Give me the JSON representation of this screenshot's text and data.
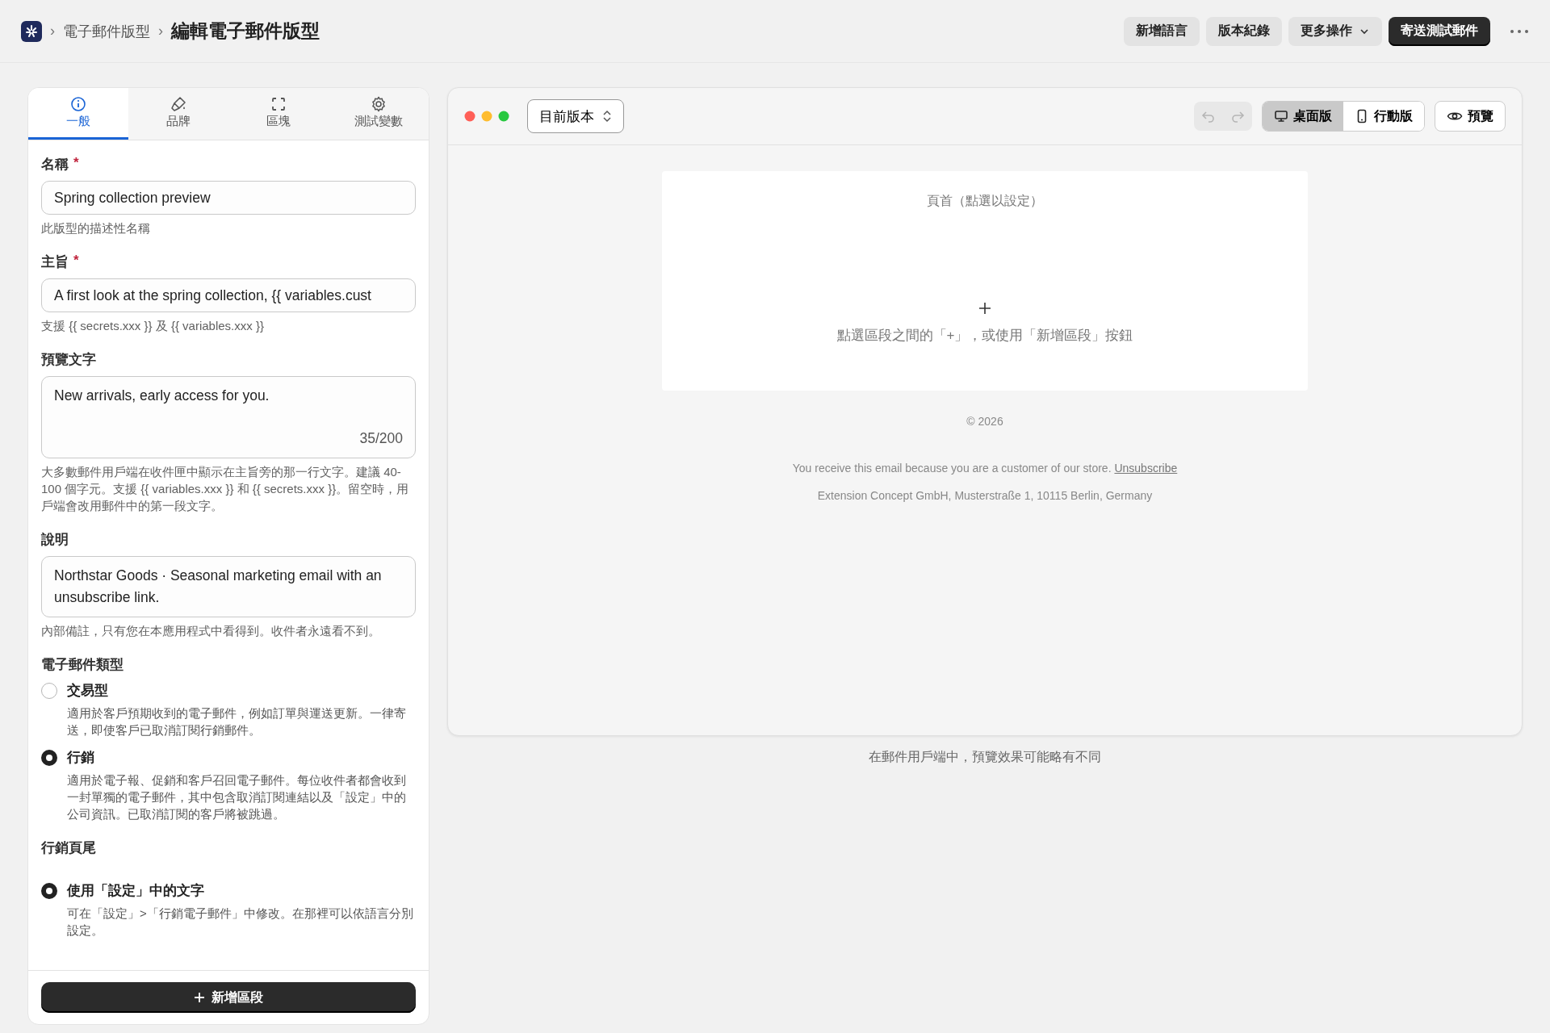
{
  "breadcrumb": [
    {
      "separator": "›",
      "label": "電子郵件版型",
      "kind": "link"
    },
    {
      "separator": "›",
      "label": "編輯電子郵件版型",
      "kind": "current"
    }
  ],
  "header_buttons": [
    {
      "label": "新增語言",
      "kind": "plain"
    },
    {
      "label": "版本紀錄",
      "kind": "plain"
    },
    {
      "label": "更多操作",
      "kind": "menu"
    },
    {
      "label": "寄送測試郵件",
      "kind": "primary"
    }
  ],
  "tabs": [
    {
      "label": "一般",
      "selected": true
    },
    {
      "label": "品牌",
      "selected": false
    },
    {
      "label": "區塊",
      "selected": false
    },
    {
      "label": "測試變數",
      "selected": false
    }
  ],
  "form": {
    "name": {
      "label": "名稱",
      "required_mark": "*",
      "value": "Spring collection preview",
      "help": "此版型的描述性名稱"
    },
    "subject": {
      "label": "主旨",
      "required_mark": "*",
      "value": "A first look at the spring collection, {{ variables.cust",
      "help": "支援 {{ secrets.xxx }} 及 {{ variables.xxx }}"
    },
    "preview_text": {
      "label": "預覽文字",
      "value": "New arrivals, early access for you.",
      "counter": "35/200",
      "help": "大多數郵件用戶端在收件匣中顯示在主旨旁的那一行文字。建議 40-100 個字元。支援 {{ variables.xxx }} 和 {{ secrets.xxx }}。留空時，用戶端會改用郵件中的第一段文字。"
    },
    "description": {
      "label": "說明",
      "value": "Northstar Goods · Seasonal marketing email with an unsubscribe link.",
      "help": "內部備註，只有您在本應用程式中看得到。收件者永遠看不到。"
    },
    "email_type": {
      "label": "電子郵件類型",
      "options": [
        {
          "label": "交易型",
          "description": "適用於客戶預期收到的電子郵件，例如訂單與運送更新。一律寄送，即使客戶已取消訂閱行銷郵件。",
          "selected": false
        },
        {
          "label": "行銷",
          "description": "適用於電子報、促銷和客戶召回電子郵件。每位收件者都會收到一封單獨的電子郵件，其中包含取消訂閱連結以及「設定」中的公司資訊。已取消訂閱的客戶將被跳過。",
          "selected": true
        }
      ]
    },
    "marketing_footer": {
      "label": "行銷頁尾",
      "options": [
        {
          "label": "使用「設定」中的文字",
          "description": "可在「設定」>「行銷電子郵件」中修改。在那裡可以依語言分別設定。",
          "selected": true
        }
      ]
    }
  },
  "add_section_button": "新增區段",
  "preview": {
    "version_select": "目前版本",
    "undo_disabled": true,
    "redo_disabled": true,
    "devices": [
      {
        "label": "桌面版",
        "selected": true
      },
      {
        "label": "行動版",
        "selected": false
      }
    ],
    "preview_button": "預覽",
    "header_placeholder": "頁首（點選以設定）",
    "empty_hint": "點選區段之間的「+」，或使用「新增區段」按鈕",
    "copyright": "© 2026",
    "footer_text": "You receive this email because you are a customer of our store.",
    "unsubscribe_link": "Unsubscribe",
    "address": "Extension Concept GmbH, Musterstraße 1, 10115 Berlin, Germany"
  },
  "preview_caption": "在郵件用戶端中，預覽效果可能略有不同"
}
